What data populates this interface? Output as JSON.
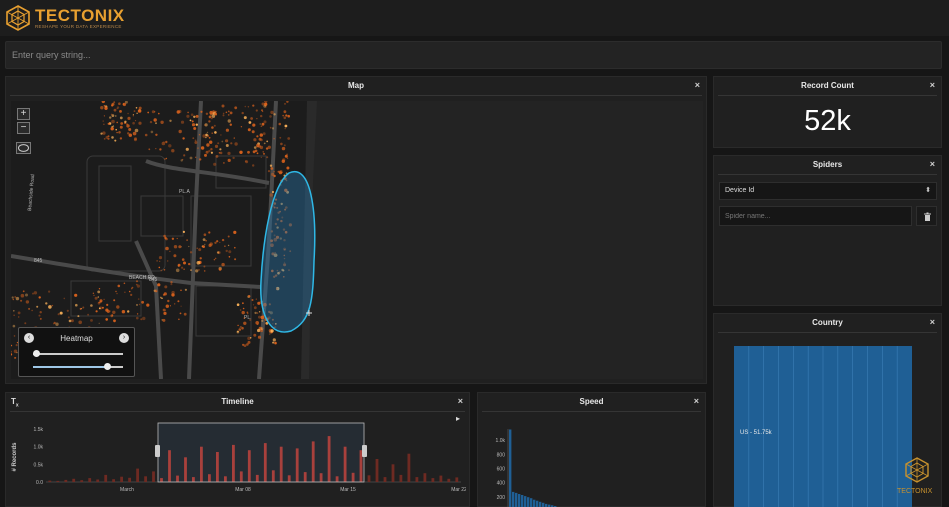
{
  "brand": {
    "name": "TECTONIX",
    "tagline": "RESHAPE YOUR DATA EXPERIENCE",
    "accent": "#e8a030"
  },
  "query": {
    "placeholder": "Enter query string..."
  },
  "map_panel": {
    "title": "Map",
    "close": "×",
    "zoom_in": "+",
    "zoom_out": "−",
    "road_labels": [
      "Beachside Road",
      "PL",
      "845",
      "845",
      "PL.",
      "845",
      "BEACH RD",
      "PL.A"
    ],
    "heatmap": {
      "label": "Heatmap",
      "prev": "‹",
      "next": "›",
      "slider1": 0.0,
      "slider2": 0.85
    }
  },
  "record_count": {
    "title": "Record Count",
    "close": "×",
    "value": "52k"
  },
  "spiders": {
    "title": "Spiders",
    "close": "×",
    "select_value": "Device Id",
    "input_placeholder": "Spider name..."
  },
  "country": {
    "title": "Country",
    "close": "×",
    "chart_data": {
      "type": "bar",
      "categories": [
        "US"
      ],
      "values": [
        51750
      ],
      "bar_label": "US - 51.75k",
      "bar_color": "#1f5f95"
    }
  },
  "timeline": {
    "title": "Timeline",
    "close": "×",
    "play": "▸",
    "corner_icon": "Tx",
    "chart_data": {
      "type": "bar",
      "ylabel": "# Records",
      "yticks": [
        "1.5k",
        "1.0k",
        "0.5k",
        "0.0"
      ],
      "yvalues": [
        1500,
        1000,
        500,
        0
      ],
      "xticks": [
        "March",
        "Mar 08",
        "Mar 15",
        "Mar 22"
      ],
      "selected_range": [
        "Mar 05",
        "Mar 16"
      ],
      "series": [
        {
          "values": [
            40,
            30,
            60,
            90,
            50,
            110,
            70,
            200,
            80,
            150,
            120,
            380,
            160,
            300,
            110,
            900,
            180,
            700,
            140,
            1000,
            220,
            850,
            160,
            1050,
            300,
            900,
            200,
            1100,
            330,
            1000,
            190,
            950,
            280,
            1150,
            250,
            1300,
            160,
            1000,
            260,
            900,
            190,
            650,
            140,
            500,
            200,
            800,
            140,
            250,
            110,
            180,
            90,
            130
          ]
        }
      ]
    }
  },
  "speed": {
    "title": "Speed",
    "close": "×",
    "chart_data": {
      "type": "bar",
      "yticks": [
        "1.0k",
        "800",
        "600",
        "400",
        "200"
      ],
      "yvalues": [
        1000,
        800,
        600,
        400,
        200
      ],
      "values": [
        1150,
        270,
        255,
        240,
        225,
        210,
        195,
        180,
        160,
        145,
        130,
        115,
        100,
        90,
        80,
        70
      ]
    }
  },
  "watermark": {
    "name": "TECTONIX"
  }
}
